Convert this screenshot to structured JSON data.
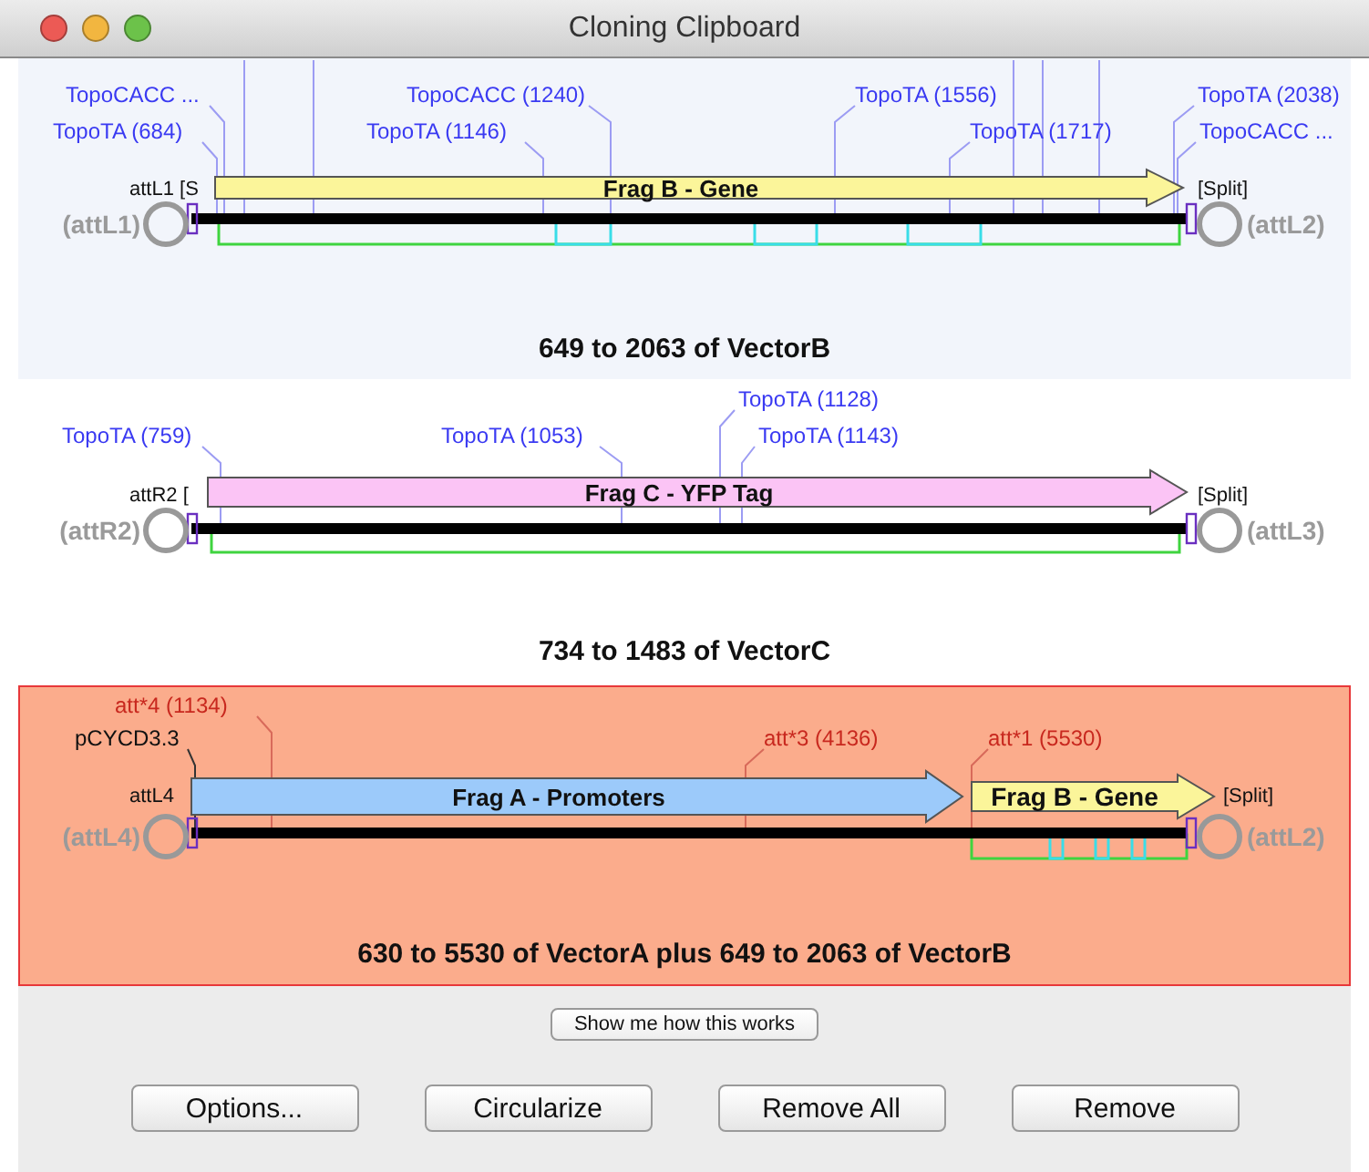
{
  "window": {
    "title": "Cloning Clipboard"
  },
  "cards": [
    {
      "selected": false,
      "caption": "649 to 2063 of VectorB",
      "left_end": "(attL1)",
      "left_tag": "attL1 [S",
      "right_tag": "[Split]",
      "right_end": "(attL2)",
      "sites": [
        {
          "label": "TopoCACC ...",
          "color": "#3a3af2"
        },
        {
          "label": "TopoCACC (1240)",
          "color": "#3a3af2"
        },
        {
          "label": "TopoTA (1556)",
          "color": "#3a3af2"
        },
        {
          "label": "TopoTA (2038)",
          "color": "#3a3af2"
        },
        {
          "label": "TopoTA (684)",
          "color": "#3a3af2"
        },
        {
          "label": "TopoTA (1146)",
          "color": "#3a3af2"
        },
        {
          "label": "TopoTA (1717)",
          "color": "#3a3af2"
        },
        {
          "label": "TopoCACC ...",
          "color": "#3a3af2"
        }
      ],
      "fragments": [
        {
          "label": "Frag B - Gene",
          "color": "#fbf59a"
        }
      ]
    },
    {
      "selected": false,
      "caption": "734 to 1483 of VectorC",
      "left_end": "(attR2)",
      "left_tag": "attR2 [",
      "right_tag": "[Split]",
      "right_end": "(attL3)",
      "sites": [
        {
          "label": "TopoTA (1128)",
          "color": "#3a3af2"
        },
        {
          "label": "TopoTA (759)",
          "color": "#3a3af2"
        },
        {
          "label": "TopoTA (1053)",
          "color": "#3a3af2"
        },
        {
          "label": "TopoTA (1143)",
          "color": "#3a3af2"
        }
      ],
      "fragments": [
        {
          "label": "Frag C - YFP Tag",
          "color": "#fbc4f5"
        }
      ]
    },
    {
      "selected": true,
      "caption": "630 to 5530 of VectorA plus 649 to 2063 of VectorB",
      "left_end": "(attL4)",
      "left_tag": "attL4",
      "right_tag": "[Split]",
      "right_end": "(attL2)",
      "sites": [
        {
          "label": "att*4 (1134)",
          "color": "#c8281e"
        },
        {
          "label": "pCYCD3.3",
          "color": "#111111"
        },
        {
          "label": "att*3 (4136)",
          "color": "#c8281e"
        },
        {
          "label": "att*1 (5530)",
          "color": "#c8281e"
        }
      ],
      "fragments": [
        {
          "label": "Frag A - Promoters",
          "color": "#9ccafa"
        },
        {
          "label": "Frag B - Gene",
          "color": "#fbf59a"
        }
      ]
    }
  ],
  "help_button": "Show me how this works",
  "buttons": [
    "Options...",
    "Circularize",
    "Remove All",
    "Remove"
  ]
}
